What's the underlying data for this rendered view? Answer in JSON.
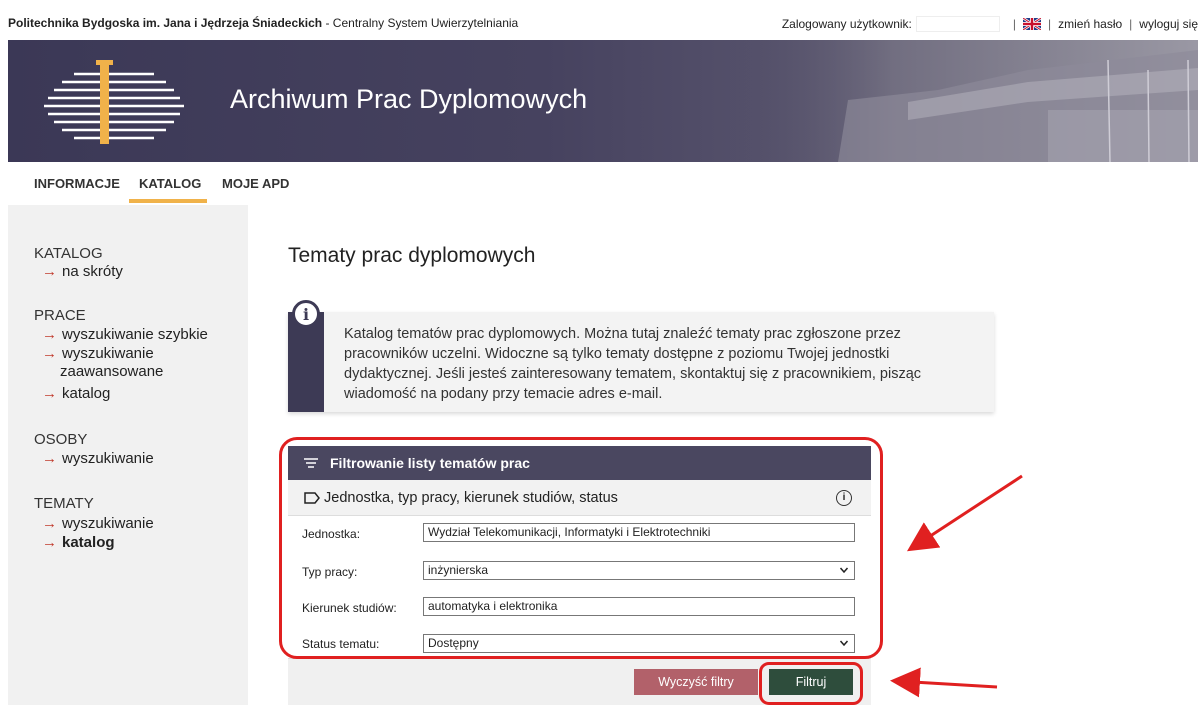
{
  "topbar": {
    "institution": "Politechnika Bydgoska im. Jana i Jędrzeja Śniadeckich",
    "system_suffix": " - Centralny System Uwierzytelniania",
    "logged_user_label": "Zalogowany użytkownik:",
    "change_password": "zmień hasło",
    "logout": "wyloguj się",
    "separator": "|"
  },
  "banner": {
    "title": "Archiwum Prac Dyplomowych"
  },
  "nav": {
    "tabs": [
      {
        "label": "INFORMACJE"
      },
      {
        "label": "KATALOG"
      },
      {
        "label": "MOJE APD"
      }
    ],
    "active": "KATALOG"
  },
  "sidebar": {
    "arrow": "→",
    "sections": [
      {
        "title": "KATALOG",
        "items": [
          "na skróty"
        ]
      },
      {
        "title": "PRACE",
        "items": [
          "wyszukiwanie szybkie",
          "wyszukiwanie",
          "zaawansowane",
          "katalog"
        ]
      },
      {
        "title": "OSOBY",
        "items": [
          "wyszukiwanie"
        ]
      },
      {
        "title": "TEMATY",
        "items": [
          "wyszukiwanie",
          "katalog"
        ]
      }
    ]
  },
  "main": {
    "title": "Tematy prac dyplomowych",
    "info_lines": [
      "Katalog tematów prac dyplomowych. Można tutaj znaleźć tematy prac zgłoszone przez",
      "pracowników uczelni. Widoczne są tylko tematy dostępne z poziomu Twojej jednostki",
      "dydaktycznej. Jeśli jesteś zainteresowany tematem, skontaktuj się z pracownikiem, pisząc",
      "wiadomość na podany przy temacie adres e-mail."
    ]
  },
  "filter": {
    "header": "Filtrowanie listy tematów prac",
    "section": "Jednostka, typ pracy, kierunek studiów, status",
    "fields": [
      {
        "label": "Jednostka:",
        "value": "Wydział Telekomunikacji, Informatyki i Elektrotechniki",
        "type": "text"
      },
      {
        "label": "Typ pracy:",
        "value": "inżynierska",
        "type": "select"
      },
      {
        "label": "Kierunek studiów:",
        "value": "automatyka i elektronika",
        "type": "text"
      },
      {
        "label": "Status tematu:",
        "value": "Dostępny",
        "type": "select"
      }
    ],
    "clear_button": "Wyczyść filtry",
    "submit_button": "Filtruj"
  },
  "colors": {
    "banner": "#3b3856",
    "accent": "#f0b24a",
    "clear": "#b2616a",
    "submit": "#2e4d3c",
    "annotation": "#e02020"
  }
}
